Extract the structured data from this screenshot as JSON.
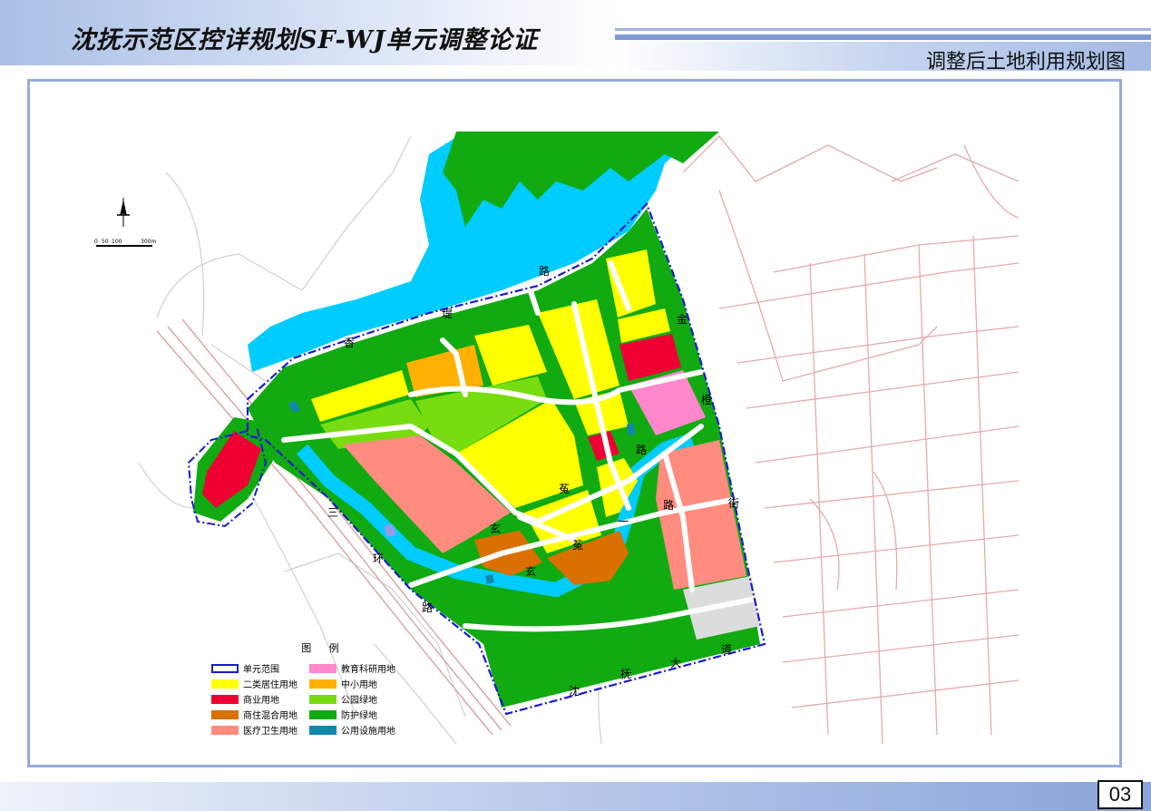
{
  "header": {
    "title": "沈抚示范区控详规划SF-WJ单元调整论证",
    "subtitle": "调整后土地利用规划图"
  },
  "page_number": "03",
  "colors": {
    "residential": "#ffff00",
    "commercial": "#ee0033",
    "mixed": "#d97000",
    "medical": "#ff8c7f",
    "education": "#ff88cc",
    "school": "#ffb000",
    "park": "#77dd11",
    "protective_green": "#11aa11",
    "utility": "#1188aa",
    "water": "#00ccff",
    "boundary": "#1a1acc",
    "road_line": "#e7a9a9"
  },
  "scale": {
    "labels": [
      "0",
      "50",
      "100",
      "",
      "300m"
    ],
    "north_icon": "north-arrow-icon"
  },
  "roads": {
    "xiangdi": [
      "香",
      "堤",
      "路"
    ],
    "jincheng": [
      "金",
      "橙",
      "路",
      "街"
    ],
    "xuantu_north": [
      "菟",
      "玄"
    ],
    "xuantu_south": [
      "一",
      "路",
      "菟",
      "玄"
    ],
    "sanhuan": [
      "三",
      "环",
      "路"
    ],
    "shenfu": [
      "沈",
      "抚",
      "大",
      "道"
    ]
  },
  "legend": {
    "title": "图 例",
    "items": [
      {
        "label": "单元范围",
        "swatch": "boundary"
      },
      {
        "label": "教育科研用地",
        "swatch": "education"
      },
      {
        "label": "二类居住用地",
        "swatch": "residential"
      },
      {
        "label": "中小用地",
        "swatch": "school"
      },
      {
        "label": "商业用地",
        "swatch": "commercial"
      },
      {
        "label": "公园绿地",
        "swatch": "park"
      },
      {
        "label": "商住混合用地",
        "swatch": "mixed"
      },
      {
        "label": "防护绿地",
        "swatch": "protective_green"
      },
      {
        "label": "医疗卫生用地",
        "swatch": "medical"
      },
      {
        "label": "公用设施用地",
        "swatch": "utility"
      }
    ]
  }
}
